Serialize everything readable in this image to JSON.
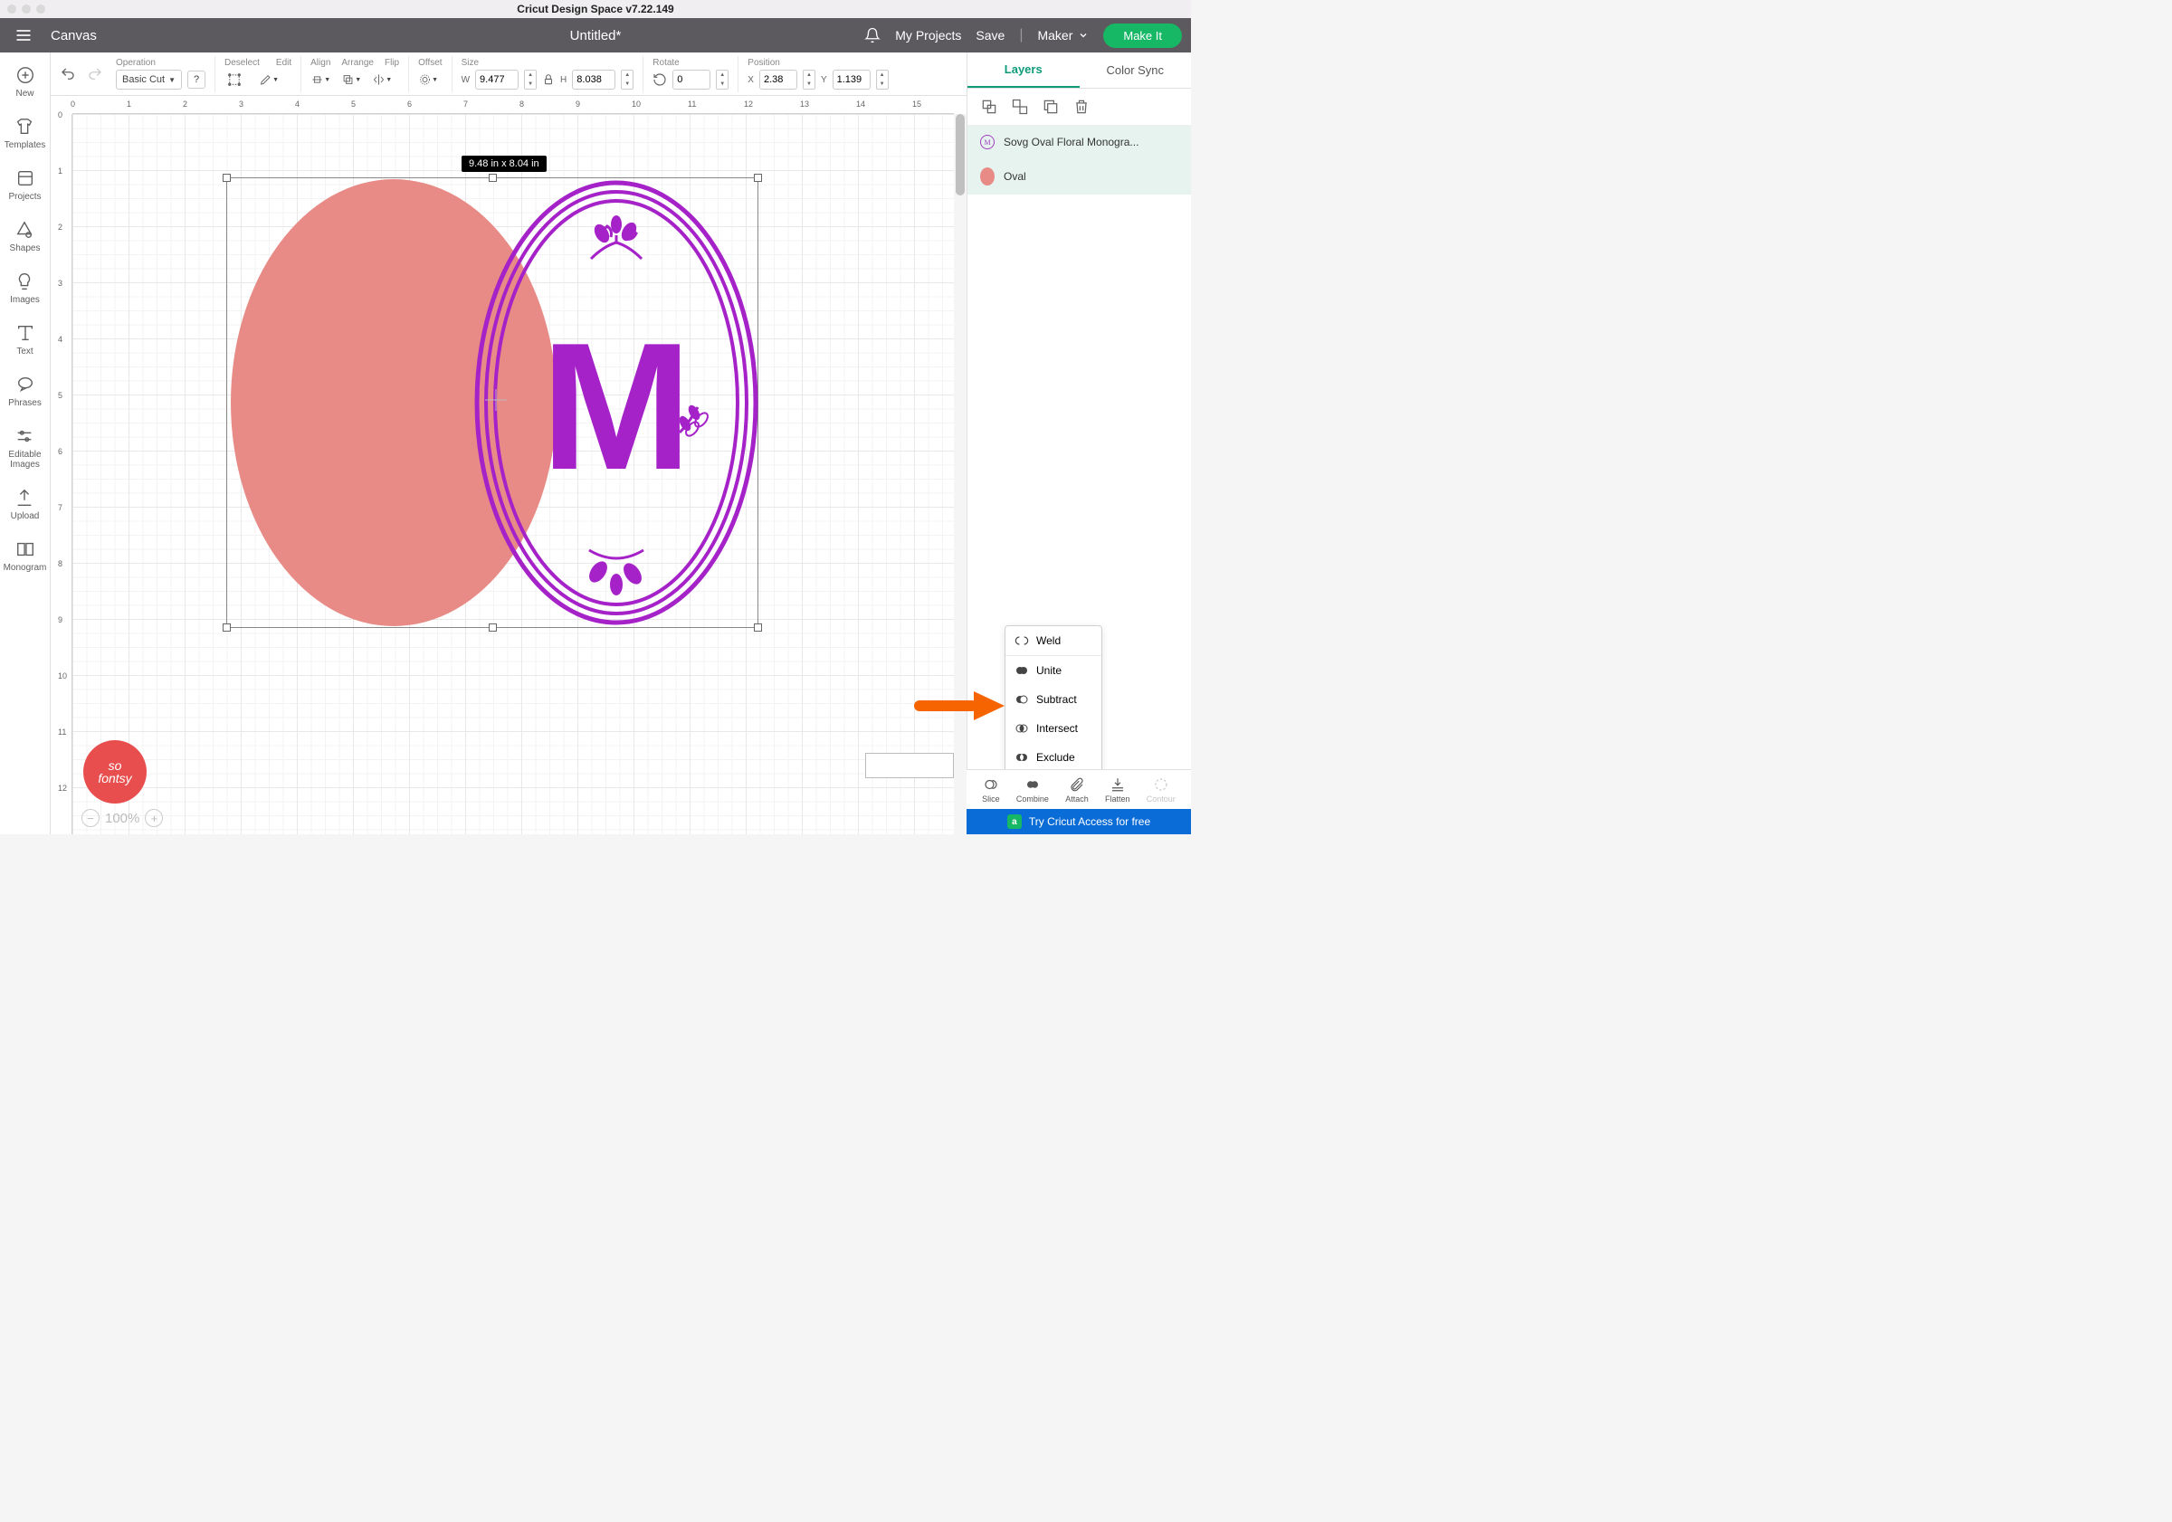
{
  "titlebar": {
    "title": "Cricut Design Space  v7.22.149"
  },
  "topnav": {
    "canvas": "Canvas",
    "doc_title": "Untitled*",
    "my_projects": "My Projects",
    "save": "Save",
    "machine": "Maker",
    "make_it": "Make It"
  },
  "leftbar": {
    "new": "New",
    "templates": "Templates",
    "projects": "Projects",
    "shapes": "Shapes",
    "images": "Images",
    "text": "Text",
    "phrases": "Phrases",
    "editable_images": "Editable\nImages",
    "upload": "Upload",
    "monogram": "Monogram"
  },
  "toolbar": {
    "operation": {
      "label": "Operation",
      "value": "Basic Cut",
      "q": "?"
    },
    "deselect": "Deselect",
    "edit": "Edit",
    "align": "Align",
    "arrange": "Arrange",
    "flip": "Flip",
    "offset": "Offset",
    "size": {
      "label": "Size",
      "w": "W",
      "w_val": "9.477",
      "h": "H",
      "h_val": "8.038"
    },
    "rotate": {
      "label": "Rotate",
      "val": "0"
    },
    "position": {
      "label": "Position",
      "x": "X",
      "x_val": "2.38",
      "y": "Y",
      "y_val": "1.139"
    }
  },
  "canvas": {
    "ruler_h": [
      "0",
      "1",
      "2",
      "3",
      "4",
      "5",
      "6",
      "7",
      "8",
      "9",
      "10",
      "11",
      "12",
      "13",
      "14",
      "15"
    ],
    "ruler_v": [
      "0",
      "1",
      "2",
      "3",
      "4",
      "5",
      "6",
      "7",
      "8",
      "9",
      "10",
      "11",
      "12"
    ],
    "dim_badge": "9.48  in x 8.04  in",
    "zoom": "100%",
    "monogram_letter": "M",
    "badge_text": "so\nfontsy"
  },
  "rightpanel": {
    "tabs": {
      "layers": "Layers",
      "color_sync": "Color Sync"
    },
    "layers": [
      {
        "name": "Sovg Oval Floral Monogra...",
        "type": "mono"
      },
      {
        "name": "Oval",
        "type": "oval"
      }
    ]
  },
  "combine_menu": {
    "weld": "Weld",
    "unite": "Unite",
    "subtract": "Subtract",
    "intersect": "Intersect",
    "exclude": "Exclude"
  },
  "bottom_actions": {
    "slice": "Slice",
    "combine": "Combine",
    "attach": "Attach",
    "flatten": "Flatten",
    "contour": "Contour"
  },
  "try_bar": {
    "a": "a",
    "text": "Try Cricut Access for free"
  }
}
